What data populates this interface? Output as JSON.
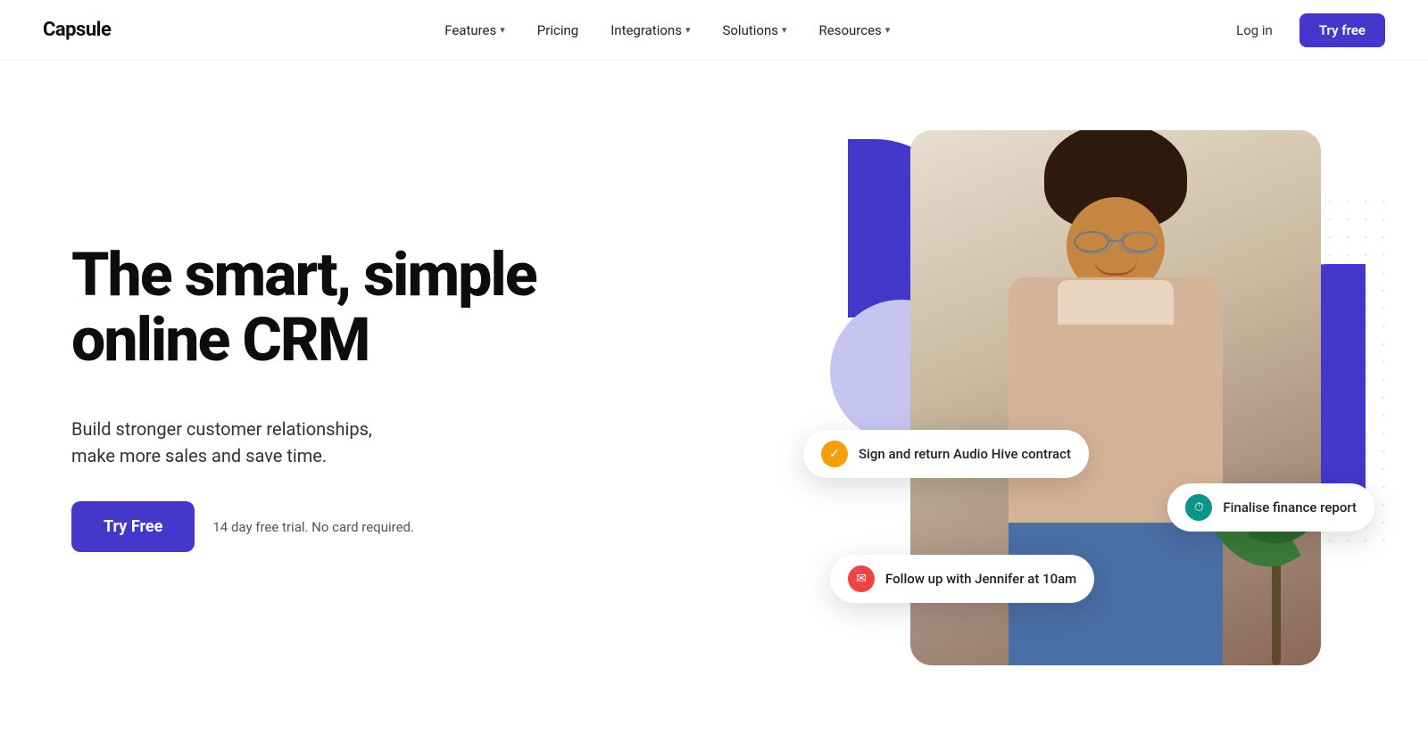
{
  "brand": {
    "name": "Capsule"
  },
  "nav": {
    "links": [
      {
        "label": "Features",
        "hasDropdown": true
      },
      {
        "label": "Pricing",
        "hasDropdown": false
      },
      {
        "label": "Integrations",
        "hasDropdown": true
      },
      {
        "label": "Solutions",
        "hasDropdown": true
      },
      {
        "label": "Resources",
        "hasDropdown": true
      }
    ],
    "login_label": "Log in",
    "try_free_label": "Try free"
  },
  "hero": {
    "heading": "The smart, simple online CRM",
    "subtext": "Build stronger customer relationships,\nmake more sales and save time.",
    "cta_button": "Try Free",
    "trial_text": "14 day free trial. No card required.",
    "notifications": [
      {
        "id": "notif-1",
        "icon": "check",
        "icon_type": "orange",
        "text": "Sign and return Audio Hive contract"
      },
      {
        "id": "notif-2",
        "icon": "clock",
        "icon_type": "teal",
        "text": "Finalise finance report"
      },
      {
        "id": "notif-3",
        "icon": "mail",
        "icon_type": "red",
        "text": "Follow up with Jennifer at 10am"
      }
    ]
  },
  "colors": {
    "primary": "#4338CA",
    "primary_hover": "#3730a3",
    "text_dark": "#0d0d0d",
    "text_muted": "#555"
  }
}
